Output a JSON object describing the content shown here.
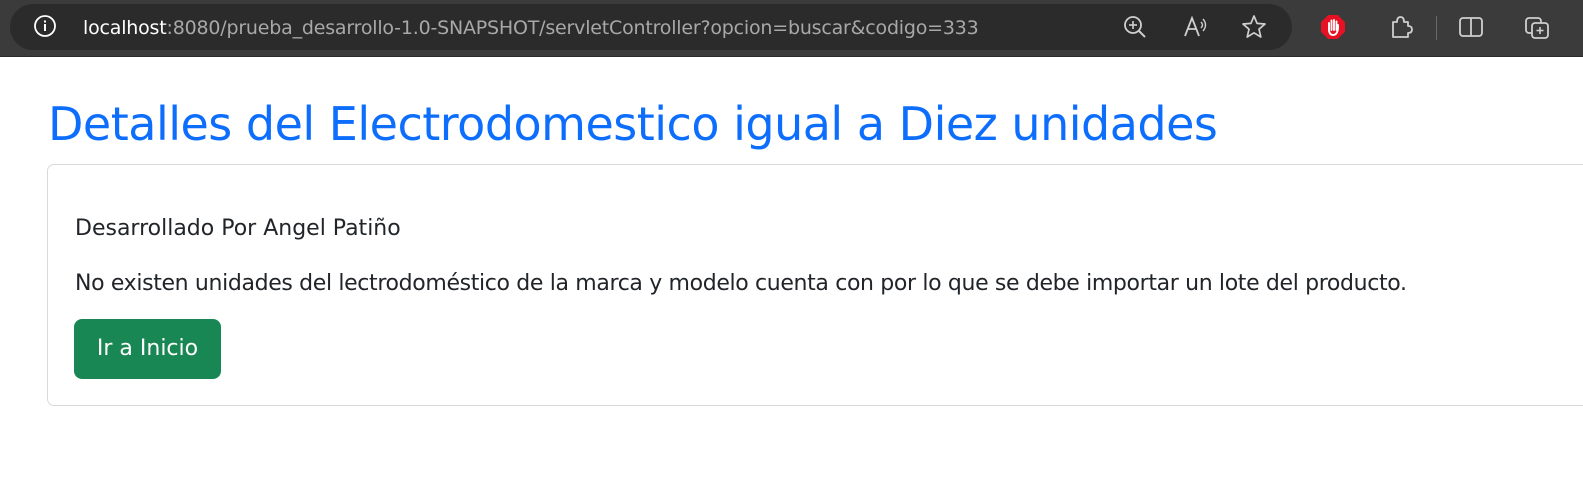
{
  "browser": {
    "url_host": "localhost",
    "url_rest": ":8080/prueba_desarrollo-1.0-SNAPSHOT/servletController?opcion=buscar&codigo=333",
    "icons": [
      "info-icon",
      "zoom-in-icon",
      "read-aloud-icon",
      "favorite-star-icon",
      "adblock-hand-icon",
      "extensions-puzzle-icon",
      "split-screen-icon",
      "collections-icon"
    ]
  },
  "page": {
    "title": "Detalles del Electrodomestico igual a Diez unidades",
    "author": "Desarrollado Por Angel Patiño",
    "message": "No existen unidades del lectrodoméstico de la marca y modelo cuenta con por lo que se debe importar un lote del producto.",
    "home_button": "Ir a Inicio"
  },
  "colors": {
    "title": "#0d6efd",
    "button": "#198754",
    "browser_bar": "#3b3b3b",
    "adblock_red": "#e81123"
  }
}
